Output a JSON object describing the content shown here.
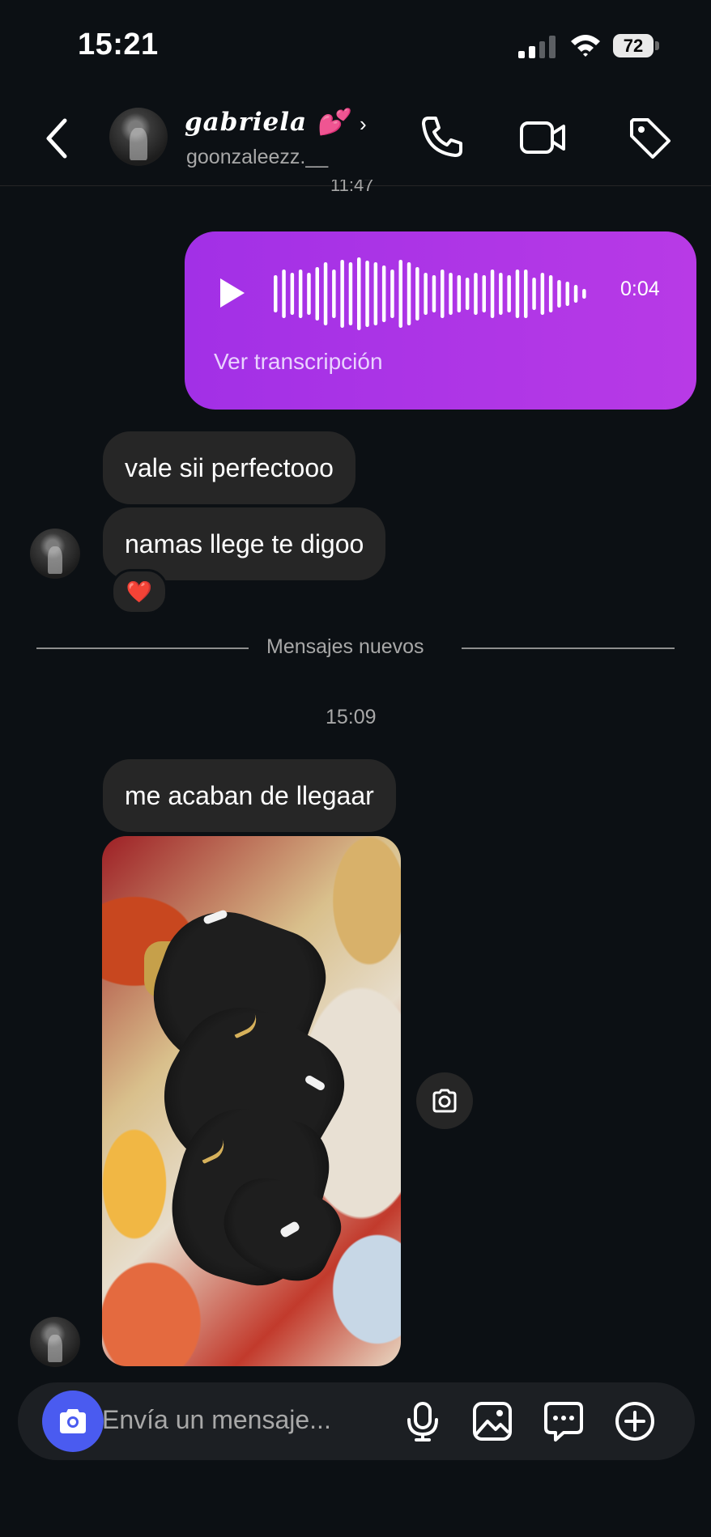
{
  "status_bar": {
    "time": "15:21",
    "battery": "72"
  },
  "header": {
    "contact_name": "gabriela 💕",
    "username": "goonzaleezz.__",
    "chevron": "›"
  },
  "thread": {
    "earlier_timestamp": "11:47",
    "voice_message": {
      "duration": "0:04",
      "transcript_link": "Ver transcripción"
    },
    "messages_before": [
      {
        "text": "vale sii perfectooo"
      },
      {
        "text": "namas llege te digoo",
        "reaction": "❤️"
      }
    ],
    "new_messages_label": "Mensajes nuevos",
    "timestamp": "15:09",
    "messages_after": [
      {
        "text": "me acaban de llegaar"
      }
    ],
    "photo": {
      "icon": "camera-icon"
    }
  },
  "composer": {
    "placeholder": "Envía un mensaje...",
    "icons": [
      "camera-icon",
      "microphone-icon",
      "gallery-icon",
      "sticker-icon",
      "plus-icon"
    ]
  },
  "colors": {
    "background": "#0c1014",
    "bubble": "#262626",
    "voice_bubble": "#b83ae6",
    "camera_button": "#4a5bf0",
    "muted_text": "#a8a8a8"
  }
}
